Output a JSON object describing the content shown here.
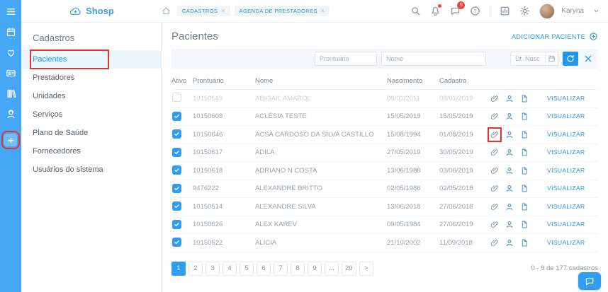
{
  "colors": {
    "accent": "#2196f3",
    "sidebar_blue": "#45a7f5",
    "annotation_red": "#e8312a"
  },
  "brand": {
    "name": "Shosp"
  },
  "icon_sidebar": {
    "items": [
      "menu-icon",
      "calendar-icon",
      "heart-icon",
      "card-icon",
      "library-icon",
      "support-icon",
      "plus-icon"
    ],
    "annotated": "plus-icon"
  },
  "header": {
    "breadcrumb_tabs": [
      {
        "label": "CADASTROS",
        "close": "×"
      },
      {
        "label": "AGENDA DE PRESTADORES",
        "close": "×"
      }
    ],
    "icons": [
      "search-icon",
      "bell-icon",
      "chat-icon",
      "help-icon",
      "chart-icon",
      "gear-icon"
    ],
    "chat_badge": "9",
    "user_name": "Karyna"
  },
  "sidenav": {
    "title": "Cadastros",
    "items": [
      {
        "label": "Pacientes",
        "active": true,
        "annotated": true
      },
      {
        "label": "Prestadores"
      },
      {
        "label": "Unidades"
      },
      {
        "label": "Serviços"
      },
      {
        "label": "Plano de Saúde"
      },
      {
        "label": "Fornecedores"
      },
      {
        "label": "Usuários do sistema"
      }
    ]
  },
  "main": {
    "title": "Pacientes",
    "add_button_label": "ADICIONAR PACIENTE",
    "filters": {
      "prontuario_placeholder": "Prontuário",
      "nome_placeholder": "Nome",
      "date_placeholder": "Dt. Nasc"
    },
    "table": {
      "headers": {
        "ativo": "Ativo",
        "prontuario": "Prontuário",
        "nome": "Nome",
        "nascimento": "Nascimento",
        "cadastro": "Cadastro"
      },
      "action_label": "VISUALIZAR",
      "row_icons": [
        "paperclip-icon",
        "user-icon",
        "document-icon"
      ],
      "rows": [
        {
          "ativo": false,
          "prontuario": "10150549",
          "nome": "ABIGAIL AMAROL",
          "nascimento": "08/01/2011",
          "cadastro": "08/01/2019",
          "inactive_style": true
        },
        {
          "ativo": true,
          "prontuario": "10150608",
          "nome": "ACLÉSIA TESTE",
          "nascimento": "15/05/2019",
          "cadastro": "15/05/2019"
        },
        {
          "ativo": true,
          "prontuario": "10150646",
          "nome": "ACSA CARDOSO DA SILVA CASTILLO",
          "nascimento": "15/08/1994",
          "cadastro": "01/08/2019",
          "annotated_icon": "paperclip-icon"
        },
        {
          "ativo": true,
          "prontuario": "10150617",
          "nome": "ADILA",
          "nascimento": "27/05/2019",
          "cadastro": "30/05/2019"
        },
        {
          "ativo": true,
          "prontuario": "10150618",
          "nome": "ADRIANO N COSTA",
          "nascimento": "13/06/1988",
          "cadastro": "03/06/2019"
        },
        {
          "ativo": true,
          "prontuario": "9476222",
          "nome": "ALEXANDRE BRITTO",
          "nascimento": "02/05/1986",
          "cadastro": "02/05/2018"
        },
        {
          "ativo": true,
          "prontuario": "10150514",
          "nome": "ALEXANDRE SILVA",
          "nascimento": "13/06/2018",
          "cadastro": "27/06/2018"
        },
        {
          "ativo": true,
          "prontuario": "10150626",
          "nome": "ALEX KAREV",
          "nascimento": "09/05/1984",
          "cadastro": "27/06/2019"
        },
        {
          "ativo": true,
          "prontuario": "10150522",
          "nome": "ALICIA",
          "nascimento": "21/10/2002",
          "cadastro": "11/09/2018"
        }
      ]
    },
    "pagination": {
      "pages": [
        "1",
        "2",
        "3",
        "4",
        "5",
        "6",
        "7",
        "8",
        "9",
        "...",
        "20",
        ">"
      ],
      "active_page": "1",
      "summary": "0 - 9 de 177 cadastros"
    }
  }
}
